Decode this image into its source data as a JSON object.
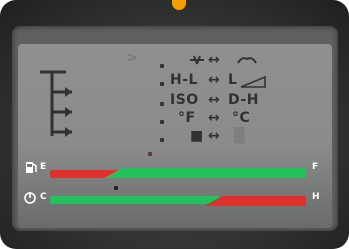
{
  "top": {
    "arrow": ">"
  },
  "rows": [
    {
      "left": "",
      "sep": "↔",
      "right": ""
    },
    {
      "left": "H-L",
      "sep": "↔",
      "right": "L"
    },
    {
      "left": "ISO",
      "sep": "↔",
      "right": "D-H"
    },
    {
      "left": "°F",
      "sep": "↔",
      "right": "°C"
    },
    {
      "left": "■",
      "sep": "↔",
      "right": "▒"
    }
  ],
  "gauges": {
    "fuel": {
      "empty_label": "E",
      "full_label": "F",
      "level": 0.7
    },
    "temp": {
      "cold_label": "C",
      "hot_label": "H",
      "level": 0.55
    }
  },
  "colors": {
    "red": "#e0302e",
    "green": "#22c25c",
    "lcd_text": "#303334",
    "accent": "#f2a000"
  },
  "icons": [
    "wiper-icon",
    "tire-icon",
    "ramp-icon",
    "fuel-pump-icon",
    "coolant-icon",
    "menu-tree-icon"
  ]
}
